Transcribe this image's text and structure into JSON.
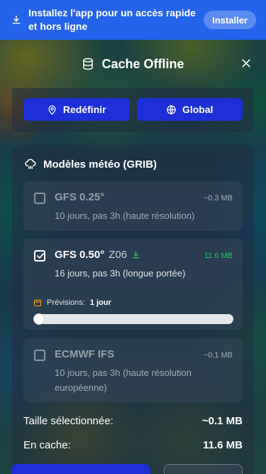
{
  "banner": {
    "message": "Installez l'app pour un accès rapide et hors ligne",
    "install_label": "Installer"
  },
  "modal": {
    "title": "Cache Offline",
    "icon": "database-icon",
    "actions": {
      "reset_label": "Redéfinir",
      "global_label": "Global"
    },
    "section_title": "Modèles météo (GRIB)",
    "models": [
      {
        "name": "GFS 0.25°",
        "run": "",
        "description": "10 jours, pas 3h (haute résolution)",
        "size": "~0.3 MB",
        "selected": false
      },
      {
        "name": "GFS 0.50°",
        "run": "Z06",
        "description": "16 jours, pas 3h (longue portée)",
        "size": "11.6 MB",
        "selected": true,
        "forecast_label": "Prévisions:",
        "forecast_value": "1 jour",
        "forecast_level": 0
      },
      {
        "name": "ECMWF IFS",
        "run": "",
        "description": "10 jours, pas 3h (haute résolution européenne)",
        "size": "~0.1 MB",
        "selected": false
      }
    ],
    "summary": {
      "selected_label": "Taille sélectionnée:",
      "selected_value": "~0.1 MB",
      "cache_label": "En cache:",
      "cache_value": "11.6 MB"
    }
  },
  "colors": {
    "banner": "#2563eb",
    "primary_button": "#1d2fd6",
    "cached_size": "#22c55e"
  }
}
